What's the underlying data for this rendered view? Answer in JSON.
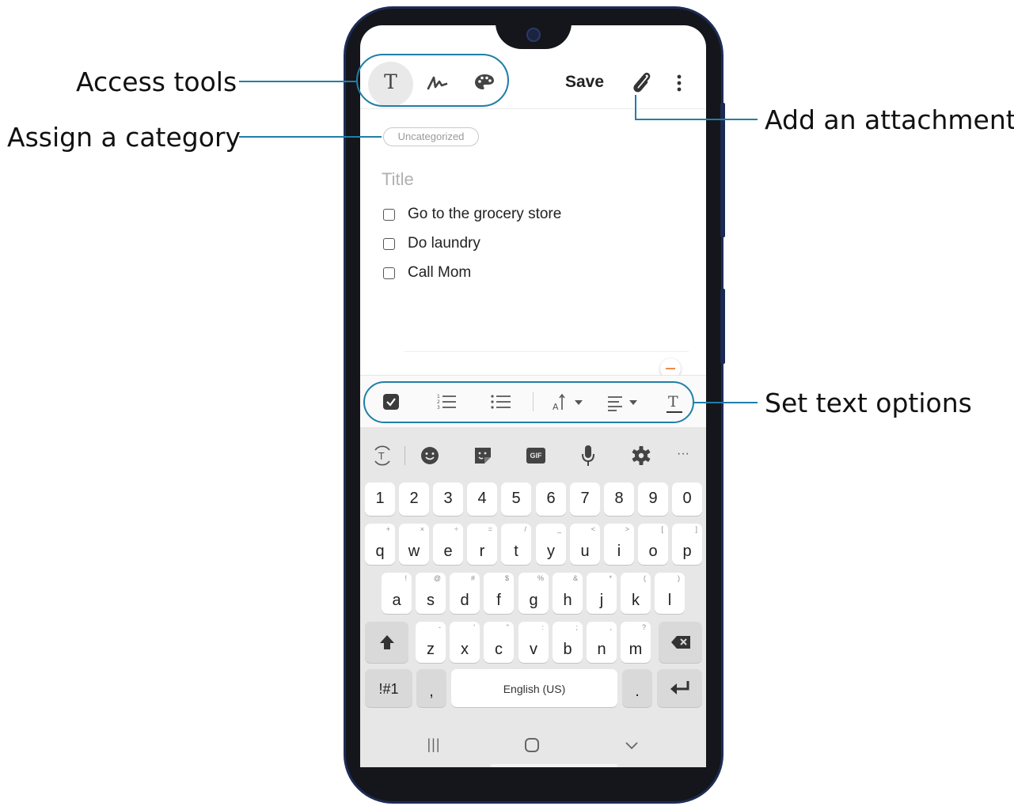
{
  "callouts": {
    "access_tools": "Access tools",
    "assign_category": "Assign a category",
    "add_attachment": "Add an attachment",
    "text_options": "Set text options"
  },
  "toolbar": {
    "text_tool_icon": "T",
    "save_label": "Save",
    "icons": [
      "text-icon",
      "handwriting-icon",
      "palette-icon",
      "paperclip-icon",
      "more-options-icon"
    ]
  },
  "note": {
    "category": "Uncategorized",
    "title_placeholder": "Title",
    "items": [
      "Go to the grocery store",
      "Do laundry",
      "Call Mom"
    ]
  },
  "format_bar": {
    "icons": [
      "checkbox-icon",
      "numbered-list-icon",
      "bulleted-list-icon",
      "text-size-icon",
      "align-icon",
      "text-style-icon"
    ]
  },
  "keyboard": {
    "toolbar_icons": [
      "translate-icon",
      "emoji-icon",
      "sticker-icon",
      "gif-icon",
      "mic-icon",
      "gear-icon",
      "more-icon"
    ],
    "gif_label": "GIF",
    "more_label": "···",
    "numbers": [
      "1",
      "2",
      "3",
      "4",
      "5",
      "6",
      "7",
      "8",
      "9",
      "0"
    ],
    "row1": [
      [
        "q",
        "+"
      ],
      [
        "w",
        "×"
      ],
      [
        "e",
        "÷"
      ],
      [
        "r",
        "="
      ],
      [
        "t",
        "/"
      ],
      [
        "y",
        "_"
      ],
      [
        "u",
        "<"
      ],
      [
        "i",
        ">"
      ],
      [
        "o",
        "["
      ],
      [
        "p",
        "]"
      ]
    ],
    "row2": [
      [
        "a",
        "!"
      ],
      [
        "s",
        "@"
      ],
      [
        "d",
        "#"
      ],
      [
        "f",
        "$"
      ],
      [
        "g",
        "%"
      ],
      [
        "h",
        "&"
      ],
      [
        "j",
        "*"
      ],
      [
        "k",
        "("
      ],
      [
        "l",
        ")"
      ]
    ],
    "row3": [
      [
        "z",
        "-"
      ],
      [
        "x",
        "'"
      ],
      [
        "c",
        "\""
      ],
      [
        "v",
        ":"
      ],
      [
        "b",
        ";"
      ],
      [
        "n",
        ","
      ],
      [
        "m",
        "?"
      ]
    ],
    "symbols_label": "!#1",
    "comma_label": ",",
    "space_label": "English (US)",
    "period_label": "."
  },
  "navbar": {
    "recents": "|||",
    "home_icon": "home-icon",
    "back_icon": "chevron-down-icon"
  },
  "colors": {
    "callout_line": "#1f7fa8",
    "phone_frame": "#1d2c55",
    "accent": "#f08a4b"
  }
}
